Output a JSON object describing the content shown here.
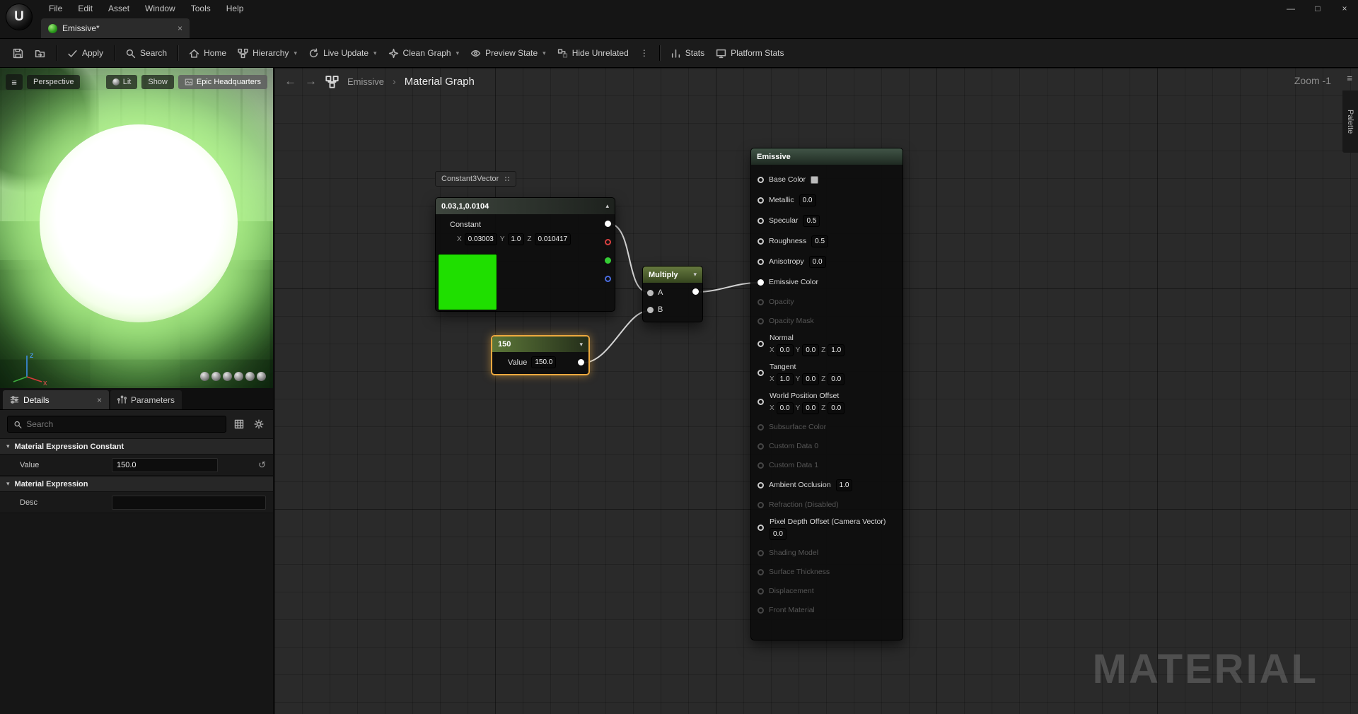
{
  "icons": {
    "minimize": "—",
    "maximize": "□",
    "close": "×",
    "caret_down": "▾",
    "caret_up": "▴",
    "hamburger": "≡",
    "back": "←",
    "forward": "→",
    "crumb_sep": "›",
    "dots": "⋮",
    "undo": "↺",
    "logo": "U"
  },
  "window": {
    "menu": [
      "File",
      "Edit",
      "Asset",
      "Window",
      "Tools",
      "Help"
    ],
    "tab_label": "Emissive*"
  },
  "toolbar": {
    "apply": "Apply",
    "search": "Search",
    "home": "Home",
    "hierarchy": "Hierarchy",
    "live_update": "Live Update",
    "clean_graph": "Clean Graph",
    "preview_state": "Preview State",
    "hide_unrelated": "Hide Unrelated",
    "stats": "Stats",
    "platform_stats": "Platform Stats"
  },
  "viewport": {
    "perspective": "Perspective",
    "lit": "Lit",
    "show": "Show",
    "scene": "Epic Headquarters",
    "axis": {
      "z": "z",
      "x": "x"
    }
  },
  "details": {
    "tab_details": "Details",
    "tab_parameters": "Parameters",
    "search_placeholder": "Search",
    "sections": {
      "constant": {
        "title": "Material Expression Constant",
        "value_label": "Value",
        "value": "150.0"
      },
      "expression": {
        "title": "Material Expression",
        "desc_label": "Desc",
        "desc": ""
      }
    }
  },
  "graph": {
    "breadcrumb": {
      "root": "Emissive",
      "current": "Material Graph"
    },
    "zoom": "Zoom -1",
    "palette_tab": "Palette",
    "watermark": "MATERIAL",
    "axis": {
      "x": "X",
      "y": "Y",
      "z": "Z"
    },
    "wire_color": "#d4d4d4",
    "nodes": {
      "comment": "Constant3Vector",
      "constant3": {
        "title": "0.03,1,0.0104",
        "type_label": "Constant",
        "x": "0.03003",
        "y": "1.0",
        "z": "0.010417",
        "swatch_color": "#1fdf00"
      },
      "multiply": {
        "title": "Multiply",
        "input_a": "A",
        "input_b": "B"
      },
      "constant150": {
        "title": "150",
        "value_label": "Value",
        "value": "150.0"
      },
      "result": {
        "title": "Emissive",
        "pins": {
          "base_color": {
            "label": "Base Color"
          },
          "metallic": {
            "label": "Metallic",
            "value": "0.0"
          },
          "specular": {
            "label": "Specular",
            "value": "0.5"
          },
          "roughness": {
            "label": "Roughness",
            "value": "0.5"
          },
          "anisotropy": {
            "label": "Anisotropy",
            "value": "0.0"
          },
          "emissive_color": {
            "label": "Emissive Color"
          },
          "opacity": {
            "label": "Opacity"
          },
          "opacity_mask": {
            "label": "Opacity Mask"
          },
          "normal": {
            "label": "Normal",
            "x": "0.0",
            "y": "0.0",
            "z": "1.0"
          },
          "tangent": {
            "label": "Tangent",
            "x": "1.0",
            "y": "0.0",
            "z": "0.0"
          },
          "world_position_offset": {
            "label": "World Position Offset",
            "x": "0.0",
            "y": "0.0",
            "z": "0.0"
          },
          "subsurface_color": {
            "label": "Subsurface Color"
          },
          "custom_data_0": {
            "label": "Custom Data 0"
          },
          "custom_data_1": {
            "label": "Custom Data 1"
          },
          "ambient_occlusion": {
            "label": "Ambient Occlusion",
            "value": "1.0"
          },
          "refraction": {
            "label": "Refraction (Disabled)"
          },
          "pixel_depth_offset": {
            "label": "Pixel Depth Offset (Camera Vector)",
            "value": "0.0"
          },
          "shading_model": {
            "label": "Shading Model"
          },
          "surface_thickness": {
            "label": "Surface Thickness"
          },
          "displacement": {
            "label": "Displacement"
          },
          "front_material": {
            "label": "Front Material"
          }
        }
      }
    }
  }
}
